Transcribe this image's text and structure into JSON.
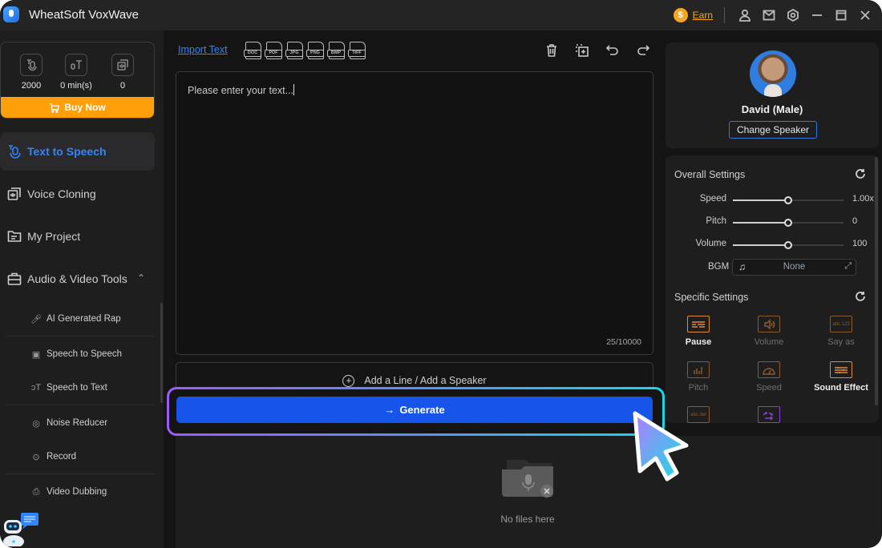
{
  "app": {
    "title": "WheatSoft VoxWave"
  },
  "titlebar": {
    "earn_label": "Earn",
    "coin_symbol": "$",
    "icons": [
      "account-icon",
      "mail-icon",
      "settings-icon",
      "minimize-icon",
      "maximize-icon",
      "close-icon"
    ]
  },
  "sidebar": {
    "stats": [
      {
        "icon": "text-to-speech-credits-icon",
        "value": "2000"
      },
      {
        "icon": "speech-to-text-minutes-icon",
        "value": "0 min(s)"
      },
      {
        "icon": "voice-clone-count-icon",
        "value": "0"
      }
    ],
    "buy_label": "Buy Now",
    "nav": [
      {
        "label": "Text to Speech",
        "active": true
      },
      {
        "label": "Voice Cloning"
      },
      {
        "label": "My Project"
      },
      {
        "label": "Audio & Video Tools",
        "expanded": true
      }
    ],
    "tools": [
      {
        "label": "AI Generated Rap"
      },
      {
        "label": "Speech to Speech"
      },
      {
        "label": "Speech to Text"
      },
      {
        "label": "Noise Reducer"
      },
      {
        "label": "Record"
      },
      {
        "label": "Video Dubbing"
      }
    ]
  },
  "main": {
    "import_label": "Import Text",
    "file_types": [
      "DOC",
      "PDF",
      "JPG",
      "PNG",
      "BMP",
      "TIFF"
    ],
    "editor": {
      "placeholder": "Please enter your text...",
      "counter": "25/10000"
    },
    "add_line_label": "Add a Line / Add a Speaker",
    "generate_label": "Generate",
    "empty_label": "No files here"
  },
  "speaker": {
    "name": "David (Male)",
    "change_label": "Change Speaker"
  },
  "overall_settings": {
    "title": "Overall Settings",
    "sliders": [
      {
        "label": "Speed",
        "value": "1.00x",
        "position": 0.5
      },
      {
        "label": "Pitch",
        "value": "0",
        "position": 0.5
      },
      {
        "label": "Volume",
        "value": "100",
        "position": 0.5
      }
    ],
    "bgm_label": "BGM",
    "bgm_value": "None"
  },
  "specific_settings": {
    "title": "Specific Settings",
    "items": [
      {
        "label": "Pause",
        "enabled": true
      },
      {
        "label": "Volume",
        "enabled": false
      },
      {
        "label": "Say as",
        "enabled": false
      },
      {
        "label": "Pitch",
        "enabled": false
      },
      {
        "label": "Speed",
        "enabled": false
      },
      {
        "label": "Sound Effect",
        "enabled": true
      },
      {
        "label": "",
        "enabled": false
      },
      {
        "label": "",
        "enabled": false
      }
    ],
    "say_as_glyph": "abc 123",
    "phoneme_glyph": "abc def"
  },
  "colors": {
    "accent_blue": "#1754ea",
    "link_blue": "#2f86ff",
    "buy_orange": "#ff9f0a",
    "earn_orange": "#f5a623",
    "setting_orange": "#e08a3c"
  }
}
